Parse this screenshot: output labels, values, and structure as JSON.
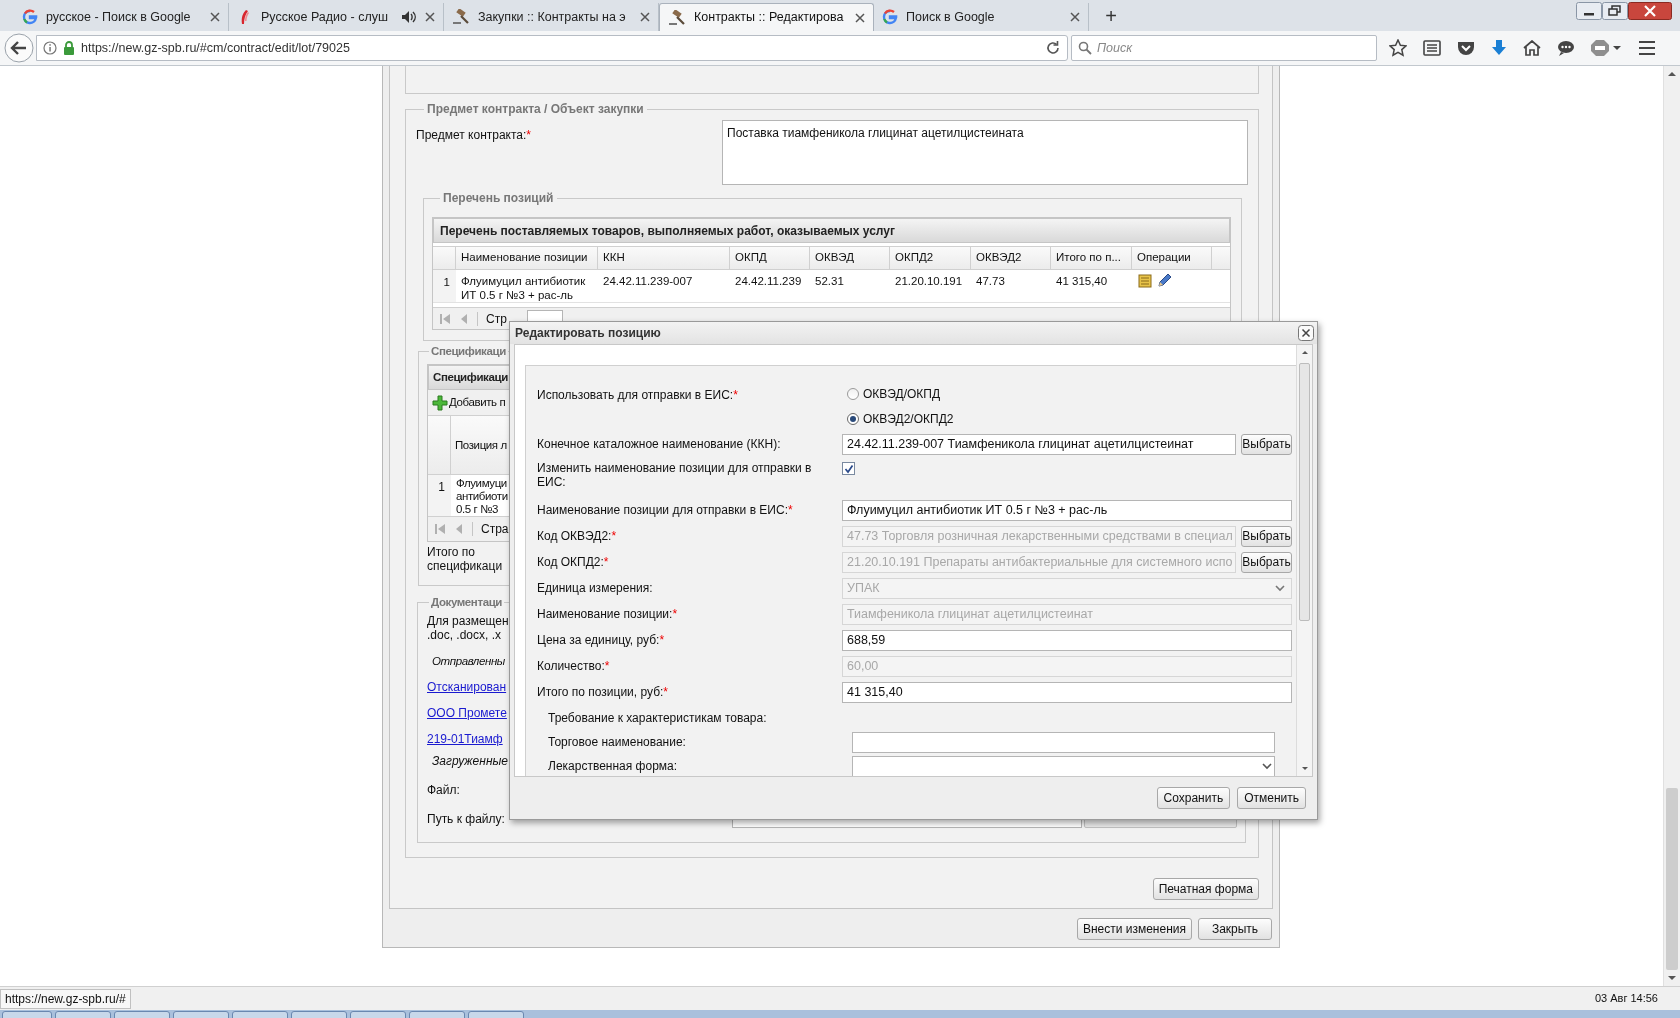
{
  "browser": {
    "tabs": [
      {
        "title": "русское - Поиск в Google",
        "kind": "search",
        "selected": false,
        "audio": false
      },
      {
        "title": "Русское Радио - слуш",
        "kind": "radio",
        "selected": false,
        "audio": true
      },
      {
        "title": "Закупки :: Контракты на э",
        "kind": "gavel",
        "selected": false,
        "audio": false
      },
      {
        "title": "Контракты :: Редактирова",
        "kind": "gavel",
        "selected": true,
        "audio": false
      },
      {
        "title": "Поиск в Google",
        "kind": "search",
        "selected": false,
        "audio": false
      }
    ],
    "new_tab": "+",
    "url": "https://new.gz-spb.ru/#cm/contract/edit/lot/79025",
    "search_placeholder": "Поиск"
  },
  "page": {
    "subject": {
      "legend": "Предмет контракта / Объект закупки",
      "label": "Предмет контракта:",
      "mark": "*",
      "value": "Поставка тиамфеникола глицинат ацетилцистеината"
    },
    "positions": {
      "legend": "Перечень позиций",
      "grid_title": "Перечень поставляемых товаров, выполняемых работ, оказываемых услуг",
      "columns": [
        "Наименование позиции",
        "ККН",
        "ОКПД",
        "ОКВЭД",
        "ОКПД2",
        "ОКВЭД2",
        "Итого по п...",
        "Операции"
      ],
      "rows": [
        {
          "num": "1",
          "cells": [
            "Флуимуцил антибиотик ИТ 0.5 г №3 + рас-ль",
            "24.42.11.239-007",
            "24.42.11.239",
            "52.31",
            "21.20.10.191",
            "47.73",
            "41 315,40"
          ]
        }
      ],
      "pager_label": "Стр"
    },
    "specification": {
      "legend": "Спецификаци",
      "grid_title": "Спецификаци",
      "add_button": "Добавить п",
      "column": "Позиция л",
      "rows": [
        {
          "num": "1",
          "lines": [
            "Флуимуци",
            "антибиоти",
            "0.5 г №3"
          ]
        }
      ],
      "pager_label": "Стра",
      "total_lines": [
        "Итого по",
        "спецификаци"
      ]
    },
    "documents": {
      "legend": "Документаци",
      "note_lines": [
        "Для размещен",
        ".doc, .docx, .x"
      ],
      "sent_label": "Отправленны",
      "links": [
        "Отсканирован",
        "ООО Промете",
        "219-01Тиамф"
      ],
      "uploaded_label": "Загруженные",
      "file_label": "Файл:",
      "path_label": "Путь к файлу:"
    },
    "print_button": "Печатная форма",
    "buttons": [
      "Внести изменения",
      "Закрыть"
    ]
  },
  "dialog": {
    "title": "Редактировать позицию",
    "send_label": "Использовать для отправки в ЕИС:",
    "send_mark": "*",
    "options": [
      {
        "label": "ОКВЭД/ОКПД",
        "selected": false
      },
      {
        "label": "ОКВЭД2/ОКПД2",
        "selected": true
      }
    ],
    "fields": [
      {
        "kind": "text",
        "label": "Конечное каталожное наименование (ККН):",
        "value": "24.42.11.239-007 Тиамфеникола глицинат ацетилцистеинат",
        "disabled": false,
        "button": "Выбрать"
      },
      {
        "kind": "checkbox",
        "label": "Изменить наименование позиции для отправки в ЕИС:",
        "checked": true
      },
      {
        "kind": "text",
        "label": "Наименование позиции для отправки в ЕИС:",
        "mark": "*",
        "value": "Флуимуцил антибиотик ИТ 0.5 г №3 + рас-ль",
        "disabled": false
      },
      {
        "kind": "text",
        "label": "Код ОКВЭД2:",
        "mark": "*",
        "value": "47.73 Торговля розничная лекарственными средствами в специал",
        "disabled": true,
        "button": "Выбрать"
      },
      {
        "kind": "text",
        "label": "Код ОКПД2:",
        "mark": "*",
        "value": "21.20.10.191 Препараты антибактериальные для системного испо",
        "disabled": true,
        "button": "Выбрать"
      },
      {
        "kind": "combo",
        "label": "Единица измерения:",
        "value": "УПАК",
        "disabled": true
      },
      {
        "kind": "text",
        "label": "Наименование позиции:",
        "mark": "*",
        "value": "Тиамфеникола глицинат ацетилцистеинат",
        "disabled": true
      },
      {
        "kind": "text",
        "label": "Цена за единицу, руб:",
        "mark": "*",
        "value": "688,59",
        "disabled": false
      },
      {
        "kind": "text",
        "label": "Количество:",
        "mark": "*",
        "value": "60,00",
        "disabled": true
      },
      {
        "kind": "text",
        "label": "Итого по позиции, руб:",
        "mark": "*",
        "value": "41 315,40",
        "disabled": false
      }
    ],
    "requirements_title": "Требование к характеристикам товара:",
    "requirements": [
      {
        "kind": "text",
        "label": "Торговое наименование:"
      },
      {
        "kind": "combo",
        "label": "Лекарственная форма:"
      }
    ],
    "buttons": [
      "Сохранить",
      "Отменить"
    ]
  },
  "status_bar": {
    "url": "https://new.gz-spb.ru/#",
    "clock": "03 Авг 14:56"
  }
}
